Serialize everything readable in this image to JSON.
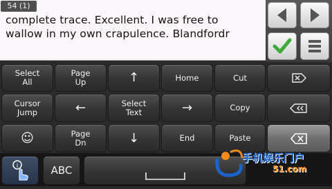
{
  "text_area": {
    "counter": "54 (1)",
    "lines": [
      "complete trace. Excellent. I was free to",
      "wallow in my own crapulence. Blandfordr"
    ]
  },
  "side_buttons": [
    "arrow-left",
    "arrow-right",
    "checkmark",
    "menu"
  ],
  "keys": {
    "select_all": "Select\nAll",
    "page_up": "Page\nUp",
    "up": "↑",
    "home": "Home",
    "cut": "Cut",
    "cursor_jump": "Cursor\nJump",
    "left": "←",
    "select_text": "Select\nText",
    "right": "→",
    "copy": "Copy",
    "emoji": "☺",
    "page_dn": "Page\nDn",
    "down": "↓",
    "end": "End",
    "paste": "Paste",
    "abc": "ABC"
  },
  "watermark": {
    "brand": "手机娱乐门户",
    "site": "51.com"
  },
  "colors": {
    "check_green": "#3fa93a",
    "key_dark": "#343434",
    "watermark_blue": "#1c63c9",
    "watermark_orange": "#f08a1c"
  }
}
